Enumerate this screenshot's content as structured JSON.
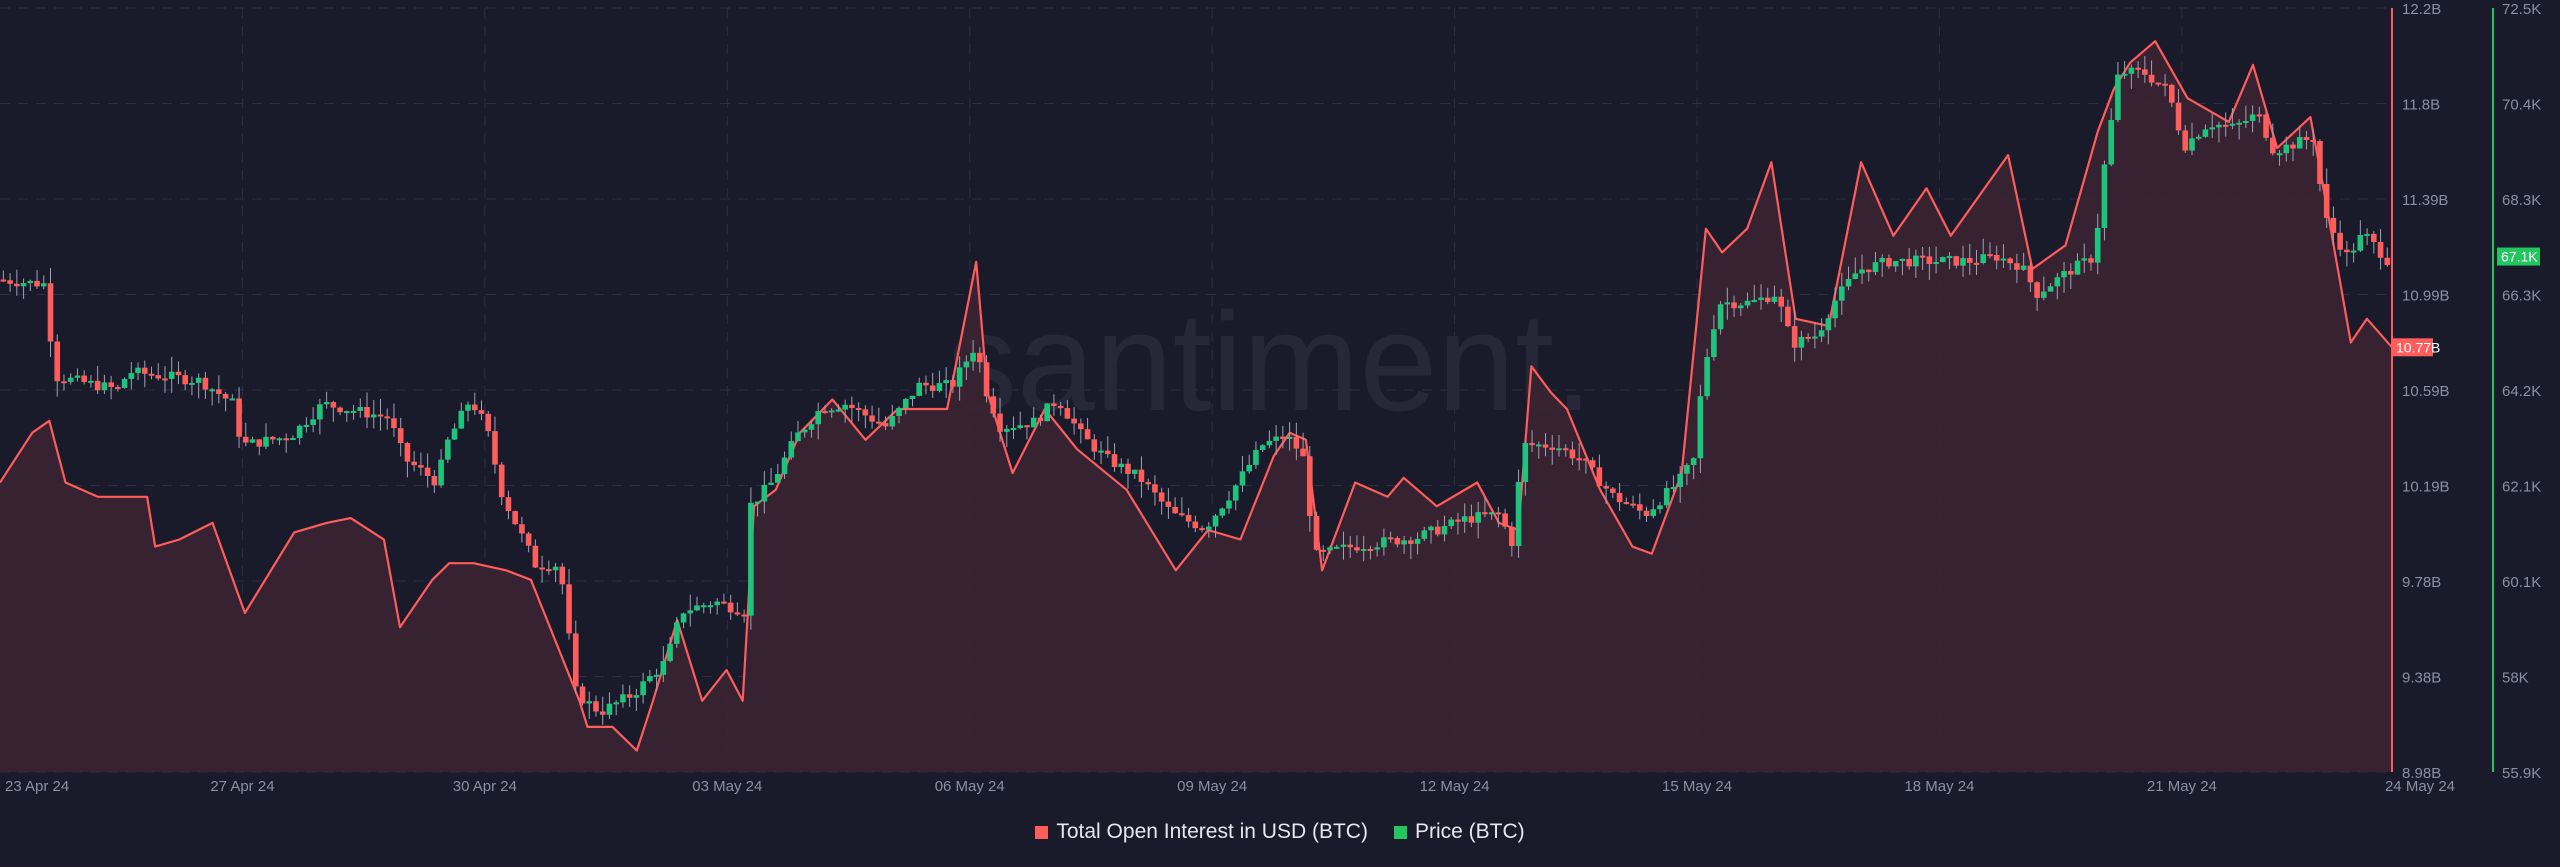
{
  "watermark": "santiment.",
  "colors": {
    "background": "#1a1b2a",
    "oi_line": "#ff5c5c",
    "oi_fill": "#3a2431",
    "candle_up": "#1fc47c",
    "candle_down": "#ff5c5c",
    "price_axis": "#22c55e",
    "grid": "#2c2f42",
    "text": "#8a8fa3"
  },
  "chart_data": {
    "type": "line+candlestick",
    "title": "",
    "legend_position": "bottom-center",
    "grid": true,
    "x_unit": "days since 24 Apr 24",
    "x_range": [
      0,
      29.6
    ],
    "x_ticks": [
      {
        "t": 0,
        "label": "23 Apr 24"
      },
      {
        "t": 3,
        "label": "27 Apr 24"
      },
      {
        "t": 6,
        "label": "30 Apr 24"
      },
      {
        "t": 9,
        "label": "03 May 24"
      },
      {
        "t": 12,
        "label": "06 May 24"
      },
      {
        "t": 15,
        "label": "09 May 24"
      },
      {
        "t": 18,
        "label": "12 May 24"
      },
      {
        "t": 21,
        "label": "15 May 24"
      },
      {
        "t": 24,
        "label": "18 May 24"
      },
      {
        "t": 27,
        "label": "21 May 24"
      },
      {
        "t": 29.9,
        "label": "24 May 24"
      }
    ],
    "series": [
      {
        "name": "Total Open Interest in USD (BTC)",
        "type": "area",
        "axis": "left-inner",
        "unit": "B USD",
        "ylim": [
          8.98,
          12.2
        ],
        "ticks": [
          "12.2B",
          "11.8B",
          "11.39B",
          "10.99B",
          "10.59B",
          "10.19B",
          "9.78B",
          "9.38B",
          "8.98B"
        ],
        "last_value_label": "10.77B",
        "points": [
          [
            0,
            10.2
          ],
          [
            0.4,
            10.41
          ],
          [
            0.61,
            10.46
          ],
          [
            0.81,
            10.2
          ],
          [
            1.21,
            10.14
          ],
          [
            1.82,
            10.14
          ],
          [
            1.92,
            9.93
          ],
          [
            2.22,
            9.96
          ],
          [
            2.63,
            10.03
          ],
          [
            3.03,
            9.65
          ],
          [
            3.64,
            9.99
          ],
          [
            4.04,
            10.03
          ],
          [
            4.34,
            10.05
          ],
          [
            4.75,
            9.96
          ],
          [
            4.95,
            9.59
          ],
          [
            5.35,
            9.79
          ],
          [
            5.56,
            9.86
          ],
          [
            5.86,
            9.86
          ],
          [
            6.26,
            9.83
          ],
          [
            6.57,
            9.79
          ],
          [
            6.77,
            9.62
          ],
          [
            7.17,
            9.28
          ],
          [
            7.27,
            9.17
          ],
          [
            7.58,
            9.17
          ],
          [
            7.88,
            9.07
          ],
          [
            8.08,
            9.28
          ],
          [
            8.38,
            9.62
          ],
          [
            8.69,
            9.28
          ],
          [
            8.99,
            9.41
          ],
          [
            9.19,
            9.28
          ],
          [
            9.33,
            10.1
          ],
          [
            9.6,
            10.17
          ],
          [
            9.9,
            10.41
          ],
          [
            10.3,
            10.55
          ],
          [
            10.71,
            10.38
          ],
          [
            11.11,
            10.51
          ],
          [
            11.72,
            10.51
          ],
          [
            12.08,
            11.13
          ],
          [
            12.22,
            10.58
          ],
          [
            12.53,
            10.24
          ],
          [
            12.93,
            10.51
          ],
          [
            13.33,
            10.34
          ],
          [
            13.94,
            10.17
          ],
          [
            14.55,
            9.83
          ],
          [
            14.95,
            10.0
          ],
          [
            15.35,
            9.96
          ],
          [
            15.76,
            10.31
          ],
          [
            15.96,
            10.41
          ],
          [
            16.16,
            10.38
          ],
          [
            16.36,
            9.83
          ],
          [
            16.77,
            10.2
          ],
          [
            17.17,
            10.14
          ],
          [
            17.37,
            10.22
          ],
          [
            17.78,
            10.1
          ],
          [
            18.28,
            10.2
          ],
          [
            18.55,
            10.03
          ],
          [
            18.79,
            10.0
          ],
          [
            18.95,
            10.69
          ],
          [
            19.19,
            10.58
          ],
          [
            19.39,
            10.51
          ],
          [
            19.8,
            10.17
          ],
          [
            20.2,
            9.93
          ],
          [
            20.44,
            9.9
          ],
          [
            20.81,
            10.24
          ],
          [
            21.11,
            11.27
          ],
          [
            21.31,
            11.17
          ],
          [
            21.62,
            11.27
          ],
          [
            21.92,
            11.55
          ],
          [
            22.22,
            10.89
          ],
          [
            22.63,
            10.86
          ],
          [
            23.03,
            11.55
          ],
          [
            23.43,
            11.24
          ],
          [
            23.84,
            11.44
          ],
          [
            24.14,
            11.24
          ],
          [
            24.85,
            11.58
          ],
          [
            25.15,
            11.1
          ],
          [
            25.56,
            11.2
          ],
          [
            25.96,
            11.68
          ],
          [
            26.16,
            11.86
          ],
          [
            26.36,
            11.97
          ],
          [
            26.67,
            12.06
          ],
          [
            27.07,
            11.82
          ],
          [
            27.58,
            11.72
          ],
          [
            27.88,
            11.96
          ],
          [
            28.18,
            11.61
          ],
          [
            28.59,
            11.74
          ],
          [
            28.79,
            11.37
          ],
          [
            29.09,
            10.79
          ],
          [
            29.29,
            10.89
          ],
          [
            29.6,
            10.77
          ]
        ]
      },
      {
        "name": "Price (BTC)",
        "type": "candlestick",
        "axis": "right",
        "unit": "K USD",
        "ylim": [
          55.9,
          72.5
        ],
        "ticks": [
          "72.5K",
          "70.4K",
          "68.3K",
          "66.3K",
          "64.2K",
          "62.1K",
          "60.1K",
          "58K",
          "55.9K"
        ],
        "last_value_label": "67.1K",
        "close_path": [
          [
            0,
            66.6
          ],
          [
            0.61,
            66.5
          ],
          [
            0.71,
            64.5
          ],
          [
            1.52,
            64.2
          ],
          [
            1.62,
            64.6
          ],
          [
            2.53,
            64.4
          ],
          [
            2.93,
            63.9
          ],
          [
            3.03,
            63.0
          ],
          [
            3.64,
            63.2
          ],
          [
            4.04,
            63.9
          ],
          [
            4.85,
            63.6
          ],
          [
            5.05,
            62.7
          ],
          [
            5.45,
            62.2
          ],
          [
            5.56,
            63.0
          ],
          [
            5.86,
            64.0
          ],
          [
            6.06,
            63.4
          ],
          [
            6.26,
            61.9
          ],
          [
            6.67,
            60.4
          ],
          [
            6.97,
            60.4
          ],
          [
            7.17,
            57.6
          ],
          [
            7.47,
            57.2
          ],
          [
            7.88,
            57.6
          ],
          [
            8.28,
            58.3
          ],
          [
            8.48,
            59.4
          ],
          [
            8.89,
            59.6
          ],
          [
            9.25,
            59.4
          ],
          [
            9.33,
            61.7
          ],
          [
            9.6,
            62.2
          ],
          [
            9.9,
            63.2
          ],
          [
            10.2,
            63.8
          ],
          [
            10.5,
            63.9
          ],
          [
            11.01,
            63.4
          ],
          [
            11.41,
            64.3
          ],
          [
            11.82,
            64.3
          ],
          [
            12.12,
            65.2
          ],
          [
            12.22,
            64.3
          ],
          [
            12.42,
            63.4
          ],
          [
            12.83,
            63.5
          ],
          [
            13.13,
            64.0
          ],
          [
            13.43,
            63.2
          ],
          [
            13.74,
            62.7
          ],
          [
            14.14,
            62.3
          ],
          [
            14.55,
            61.5
          ],
          [
            14.95,
            61.2
          ],
          [
            15.25,
            61.9
          ],
          [
            15.66,
            63.0
          ],
          [
            15.96,
            63.2
          ],
          [
            16.16,
            62.8
          ],
          [
            16.32,
            60.6
          ],
          [
            16.77,
            60.8
          ],
          [
            17.58,
            61.0
          ],
          [
            18.18,
            61.4
          ],
          [
            18.59,
            61.5
          ],
          [
            18.75,
            60.9
          ],
          [
            18.89,
            63.0
          ],
          [
            19.29,
            63.0
          ],
          [
            19.6,
            62.7
          ],
          [
            20.0,
            61.9
          ],
          [
            20.4,
            61.5
          ],
          [
            20.81,
            62.2
          ],
          [
            21.01,
            62.7
          ],
          [
            21.11,
            64.5
          ],
          [
            21.31,
            66.1
          ],
          [
            21.72,
            66.1
          ],
          [
            22.02,
            66.3
          ],
          [
            22.22,
            65.2
          ],
          [
            22.53,
            65.4
          ],
          [
            22.73,
            66.1
          ],
          [
            23.03,
            66.8
          ],
          [
            23.43,
            67.0
          ],
          [
            23.94,
            67.0
          ],
          [
            24.44,
            67.0
          ],
          [
            24.75,
            67.1
          ],
          [
            25.05,
            66.9
          ],
          [
            25.25,
            66.3
          ],
          [
            25.66,
            66.8
          ],
          [
            25.96,
            67.1
          ],
          [
            26.06,
            68.8
          ],
          [
            26.26,
            71.1
          ],
          [
            26.57,
            71.1
          ],
          [
            26.87,
            70.7
          ],
          [
            27.07,
            69.5
          ],
          [
            27.37,
            70.0
          ],
          [
            27.68,
            69.9
          ],
          [
            27.98,
            70.2
          ],
          [
            28.18,
            69.4
          ],
          [
            28.69,
            69.7
          ],
          [
            28.79,
            68.0
          ],
          [
            29.09,
            67.1
          ],
          [
            29.29,
            67.6
          ],
          [
            29.6,
            67.0
          ]
        ]
      }
    ]
  },
  "legend": [
    {
      "label": "Total Open Interest in USD (BTC)",
      "color": "#ff5c5c"
    },
    {
      "label": "Price (BTC)",
      "color": "#22c55e"
    }
  ]
}
